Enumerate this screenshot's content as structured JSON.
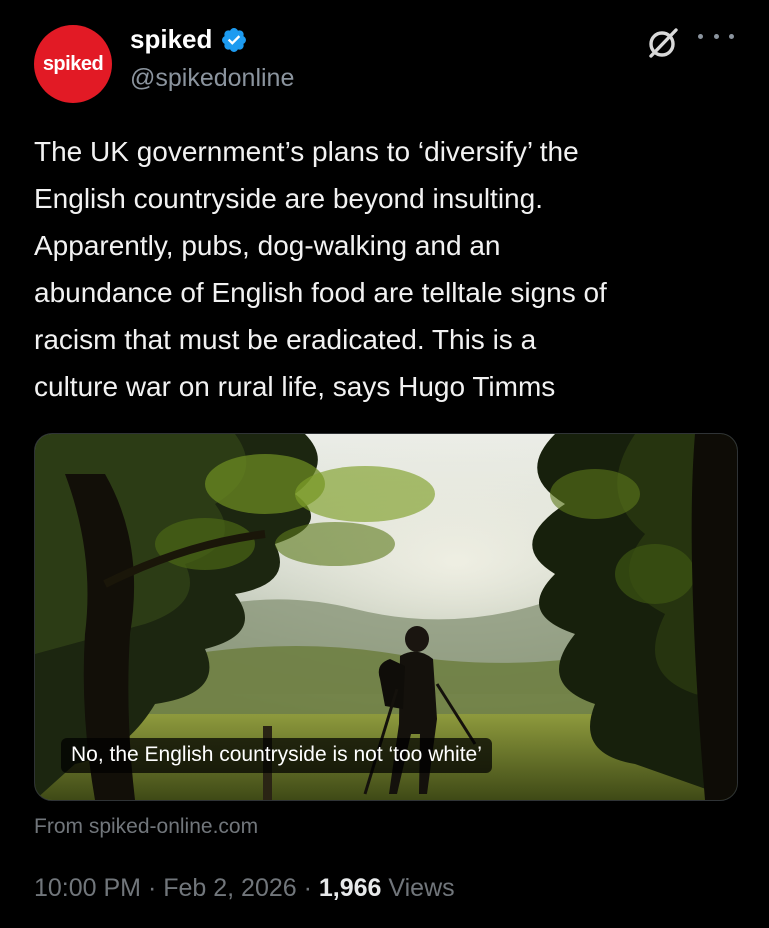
{
  "header": {
    "avatar_text": "spiked",
    "display_name": "spiked",
    "handle": "@spikedonline",
    "verified_icon": "verified-badge-icon",
    "grok_icon": "grok-icon",
    "more_icon": "more-options-icon"
  },
  "tweet": {
    "text": "The UK government’s plans to ‘diversify’ the\nEnglish countryside are beyond insulting.\nApparently, pubs, dog-walking and an\nabundance of English food are telltale signs of\nracism that must be eradicated. This is a\nculture war on rural life, says Hugo Timms"
  },
  "card": {
    "title": "No, the English countryside is not ‘too white’",
    "image_description_icon": "countryside-photo"
  },
  "source": {
    "text": "From spiked-online.com"
  },
  "meta": {
    "time": "10:00 PM",
    "separator1": " · ",
    "date": "Feb 2, 2026",
    "separator2": " · ",
    "views_count": "1,966",
    "views_label": " Views"
  },
  "colors": {
    "background": "#000000",
    "brand_red": "#e21a25",
    "verified_blue": "#1d9bf0",
    "muted": "#71767b"
  }
}
